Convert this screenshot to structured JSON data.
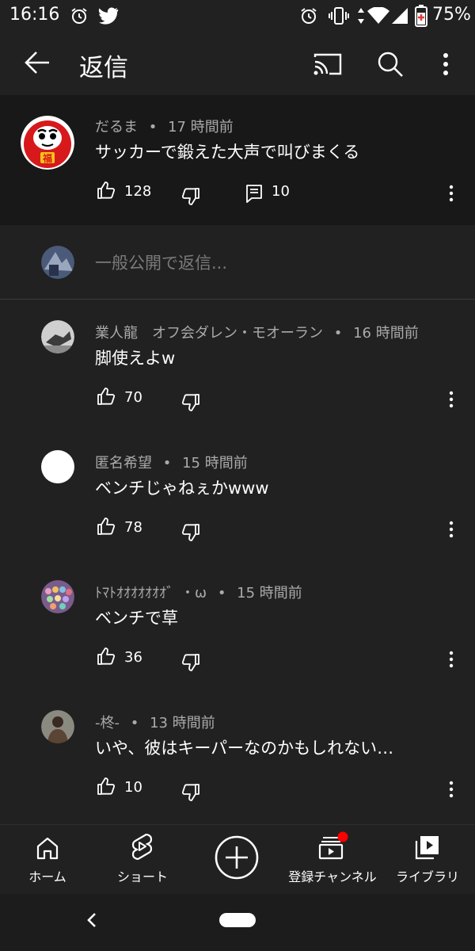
{
  "status_bar": {
    "time": "16:16",
    "battery": "75%"
  },
  "app_bar": {
    "title": "返信"
  },
  "parent_comment": {
    "author": "だるま",
    "age": "17 時間前",
    "text": "サッカーで鍛えた大声で叫びまくる",
    "likes": "128",
    "replies": "10"
  },
  "reply_box": {
    "placeholder": "一般公開で返信..."
  },
  "replies": [
    {
      "author": "業人龍　オフ会ダレン・モオーラン",
      "age": "16 時間前",
      "text": "脚使えよw",
      "likes": "70"
    },
    {
      "author": "匿名希望",
      "age": "15 時間前",
      "text": "ベンチじゃねぇかwww",
      "likes": "78"
    },
    {
      "author": "ﾄﾏﾄｵｵｵｵｵｵｵ゛・ω",
      "age": "15 時間前",
      "text": "ベンチで草",
      "likes": "36"
    },
    {
      "author": "-柊-",
      "age": "13 時間前",
      "text": "いや、彼はキーパーなのかもしれない…",
      "likes": "10"
    }
  ],
  "separator": "•",
  "bottom_nav": {
    "home": "ホーム",
    "shorts": "ショート",
    "subscriptions": "登録チャンネル",
    "library": "ライブラリ"
  },
  "colors": {
    "background": "#212121",
    "parent_background": "#181818",
    "meta_text": "#aaaaaa",
    "notification_dot": "#ff0000"
  }
}
